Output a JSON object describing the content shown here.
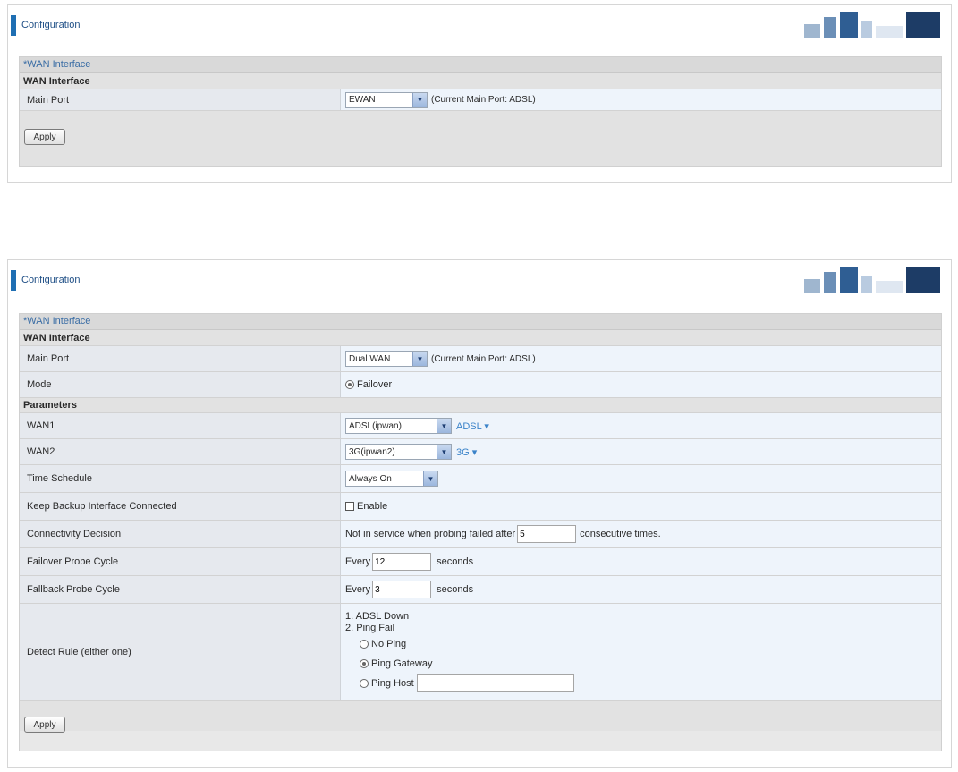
{
  "panels": [
    {
      "title": "Configuration",
      "frame_title": "WAN Interface",
      "section_title": "WAN Interface",
      "main_port_label": "Main Port",
      "main_port_value": "EWAN",
      "current_main_port": "(Current Main Port: ADSL)",
      "apply_label": "Apply"
    },
    {
      "title": "Configuration",
      "frame_title": "WAN Interface",
      "section_title": "WAN Interface",
      "main_port_label": "Main Port",
      "main_port_value": "Dual WAN",
      "current_main_port": "(Current Main Port: ADSL)",
      "mode_label": "Mode",
      "mode_value": "Failover",
      "parameters_title": "Parameters",
      "wan1_label": "WAN1",
      "wan1_value": "ADSL(ipwan)",
      "wan1_link": "ADSL",
      "wan2_label": "WAN2",
      "wan2_value": "3G(ipwan2)",
      "wan2_link": "3G",
      "link_marker": "▾",
      "schedule_label": "Time Schedule",
      "schedule_value": "Always On",
      "keep_backup_label": "Keep Backup Interface Connected",
      "enable_label": "Enable",
      "connectivity_label": "Connectivity Decision",
      "connectivity_prefix": "Not in service when probing failed after",
      "connectivity_value": "5",
      "connectivity_suffix": "consecutive times.",
      "failover_label": "Failover Probe Cycle",
      "every_label": "Every",
      "failover_value": "12",
      "seconds_label": "seconds",
      "fallback_label": "Fallback Probe Cycle",
      "fallback_value": "3",
      "detect_label": "Detect Rule (either one)",
      "detect_rule1": "1. ADSL Down",
      "detect_rule2": "2. Ping Fail",
      "no_ping_label": "No Ping",
      "ping_gateway_label": "Ping Gateway",
      "ping_host_label": "Ping Host",
      "ping_host_value": "",
      "apply_label": "Apply"
    }
  ],
  "colors": {
    "accent": "#1f6fb3",
    "link": "#3b83c9"
  },
  "icons": {
    "dropdown": "▼",
    "banner": "decorative-banner-art"
  }
}
